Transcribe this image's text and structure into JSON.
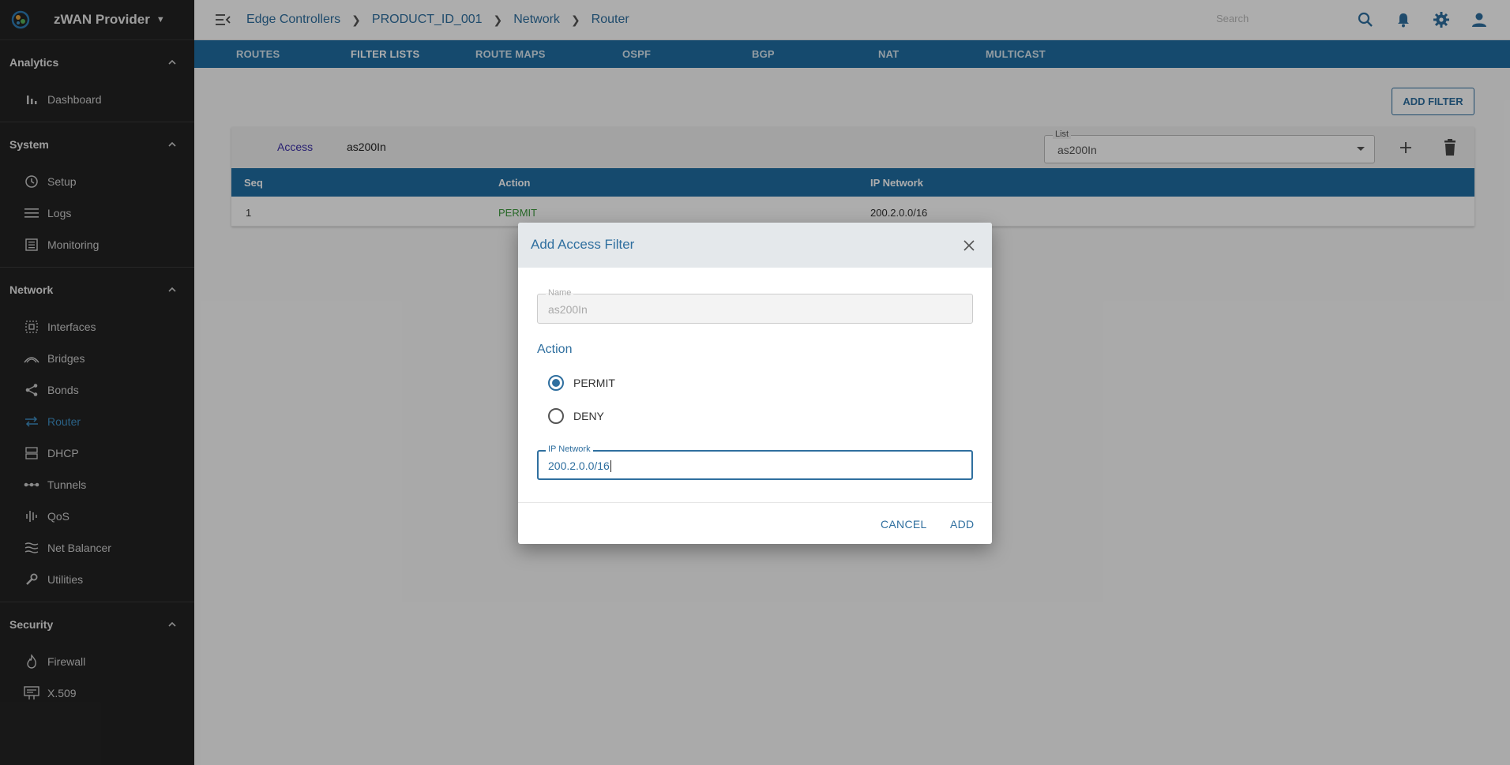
{
  "app": {
    "name": "zWAN Provider"
  },
  "sidebar": {
    "sections": [
      {
        "title": "Analytics",
        "items": [
          {
            "label": "Dashboard"
          }
        ]
      },
      {
        "title": "System",
        "items": [
          {
            "label": "Setup"
          },
          {
            "label": "Logs"
          },
          {
            "label": "Monitoring"
          }
        ]
      },
      {
        "title": "Network",
        "items": [
          {
            "label": "Interfaces"
          },
          {
            "label": "Bridges"
          },
          {
            "label": "Bonds"
          },
          {
            "label": "Router"
          },
          {
            "label": "DHCP"
          },
          {
            "label": "Tunnels"
          },
          {
            "label": "QoS"
          },
          {
            "label": "Net Balancer"
          },
          {
            "label": "Utilities"
          }
        ]
      },
      {
        "title": "Security",
        "items": [
          {
            "label": "Firewall"
          },
          {
            "label": "X.509"
          }
        ]
      }
    ],
    "active_item": "Router"
  },
  "header": {
    "breadcrumbs": [
      "Edge Controllers",
      "PRODUCT_ID_001",
      "Network",
      "Router"
    ],
    "search_placeholder": "Search"
  },
  "tabs": [
    "ROUTES",
    "FILTER LISTS",
    "ROUTE MAPS",
    "OSPF",
    "BGP",
    "NAT",
    "MULTICAST"
  ],
  "active_tab": "FILTER LISTS",
  "content": {
    "add_filter_label": "ADD FILTER",
    "card": {
      "type_label": "Access",
      "list_name": "as200In",
      "list_select": {
        "label": "List",
        "value": "as200In"
      },
      "columns": [
        "Seq",
        "Action",
        "IP Network"
      ],
      "rows": [
        {
          "seq": "1",
          "action": "PERMIT",
          "ip_network": "200.2.0.0/16"
        }
      ]
    }
  },
  "dialog": {
    "title": "Add Access Filter",
    "name_field": {
      "label": "Name",
      "value": "as200In"
    },
    "action_title": "Action",
    "options": [
      {
        "label": "PERMIT",
        "selected": true
      },
      {
        "label": "DENY",
        "selected": false
      }
    ],
    "ip_field": {
      "label": "IP Network",
      "value": "200.2.0.0/16"
    },
    "cancel_label": "CANCEL",
    "add_label": "ADD"
  },
  "colors": {
    "accent": "#2f6f9f",
    "tabbar": "#1f6ea3",
    "sidebar": "#232323",
    "permit": "#3b9a3b"
  }
}
